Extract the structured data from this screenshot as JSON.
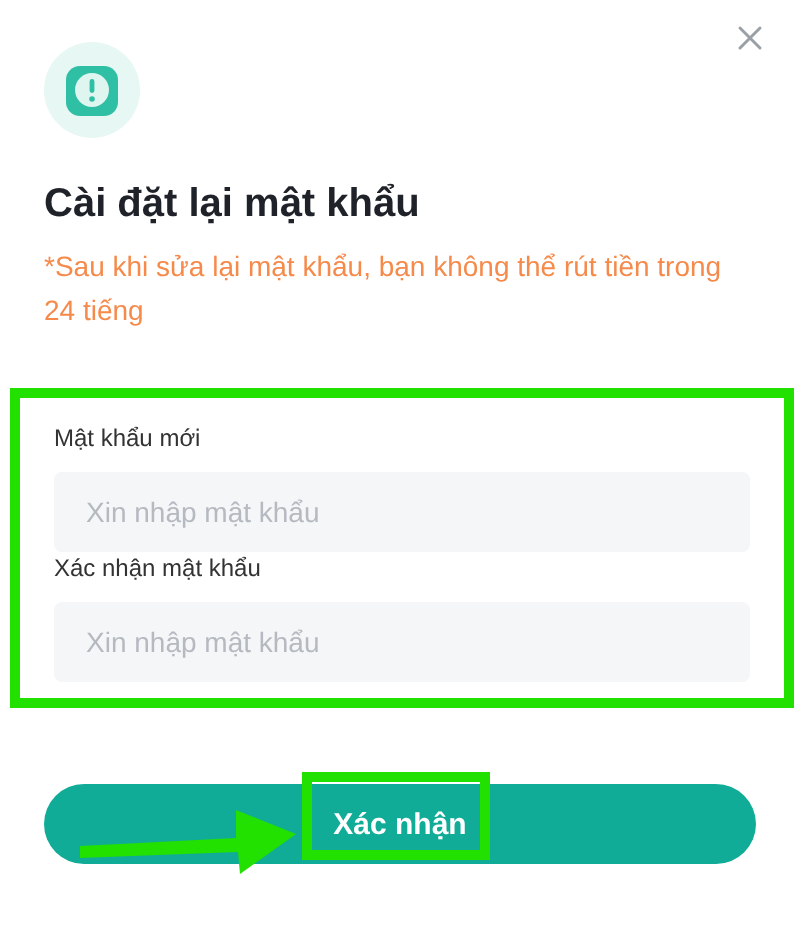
{
  "dialog": {
    "title": "Cài đặt lại mật khẩu",
    "note": "*Sau khi sửa lại mật khẩu, bạn không thể rút tiền trong 24 tiếng",
    "fields": [
      {
        "label": "Mật khẩu mới",
        "placeholder": "Xin nhập mật khẩu"
      },
      {
        "label": "Xác nhận mật khẩu",
        "placeholder": "Xin nhập mật khẩu"
      }
    ],
    "confirm_button": "Xác nhận"
  }
}
